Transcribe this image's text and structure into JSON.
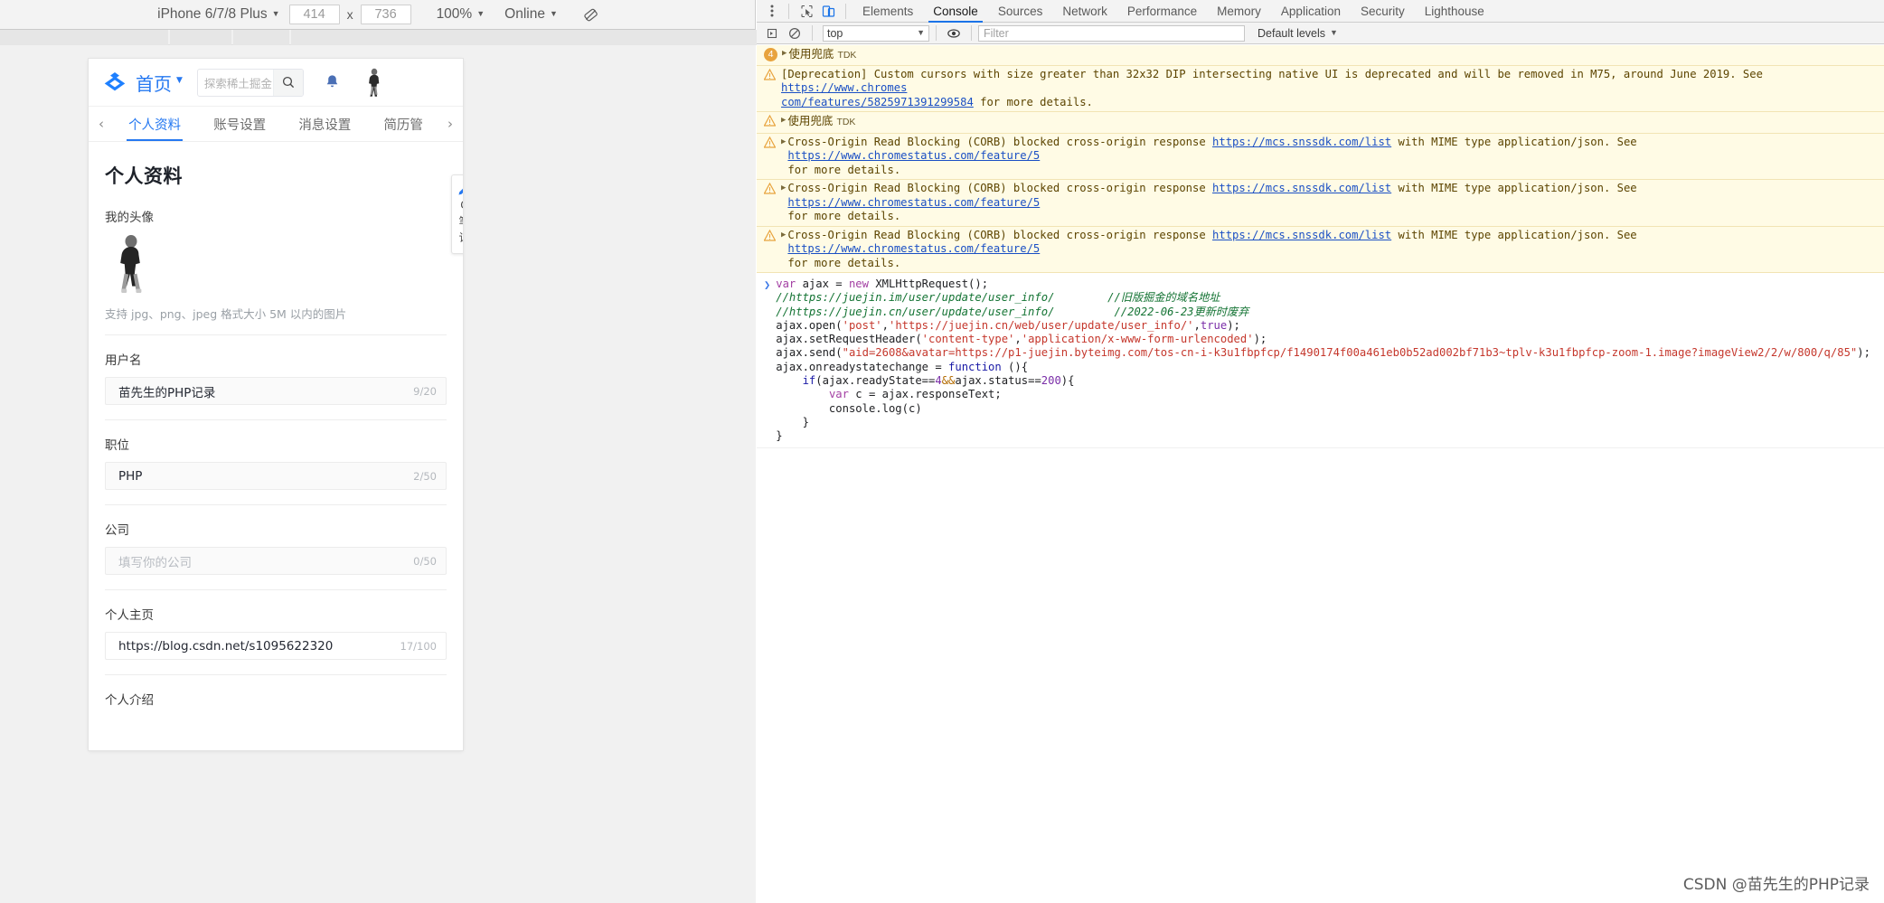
{
  "device_toolbar": {
    "device": "iPhone 6/7/8 Plus",
    "width": "414",
    "height": "736",
    "zoom": "100%",
    "throttling": "Online",
    "rotate_icon": "rotate-icon"
  },
  "phone_page": {
    "header": {
      "logo_icon": "juejin-logo-icon",
      "home_label": "首页",
      "search_placeholder": "探索稀土掘金",
      "search_icon": "search-icon",
      "bell_icon": "notification-bell-icon",
      "avatar_icon": "user-avatar-icon"
    },
    "tabs": {
      "prev_icon": "chevron-left-icon",
      "next_icon": "chevron-right-icon",
      "items": [
        {
          "label": "个人资料",
          "active": true
        },
        {
          "label": "账号设置",
          "active": false
        },
        {
          "label": "消息设置",
          "active": false
        },
        {
          "label": "简历管",
          "active": false
        }
      ]
    },
    "page_title": "个人资料",
    "avatar_section": {
      "label": "我的头像",
      "hint": "支持 jpg、png、jpeg 格式大小 5M 以内的图片"
    },
    "fields": [
      {
        "label": "用户名",
        "value": "苗先生的PHP记录",
        "placeholder": "",
        "count": "9/20",
        "filled": true
      },
      {
        "label": "职位",
        "value": "PHP",
        "placeholder": "",
        "count": "2/50",
        "filled": true
      },
      {
        "label": "公司",
        "value": "",
        "placeholder": "填写你的公司",
        "count": "0/50",
        "filled": true
      },
      {
        "label": "个人主页",
        "value": "https://blog.csdn.net/s1095622320",
        "placeholder": "",
        "count": "17/100",
        "filled": false
      }
    ],
    "bottom_label": "个人介绍",
    "note_widget": {
      "icon": "pencil-note-icon",
      "lines": [
        "C",
        "笔",
        "记"
      ]
    }
  },
  "devtools": {
    "kebab_icon": "more-options-icon",
    "inspect_icon": "inspect-element-icon",
    "device_toggle_icon": "device-toolbar-icon",
    "tabs": [
      {
        "label": "Elements",
        "active": false
      },
      {
        "label": "Console",
        "active": true
      },
      {
        "label": "Sources",
        "active": false
      },
      {
        "label": "Network",
        "active": false
      },
      {
        "label": "Performance",
        "active": false
      },
      {
        "label": "Memory",
        "active": false
      },
      {
        "label": "Application",
        "active": false
      },
      {
        "label": "Security",
        "active": false
      },
      {
        "label": "Lighthouse",
        "active": false
      }
    ],
    "subbar": {
      "clear_icon": "clear-console-icon",
      "sidebar_icon": "console-sidebar-icon",
      "context": "top",
      "eye_icon": "live-expression-icon",
      "filter_placeholder": "Filter",
      "levels": "Default levels"
    },
    "console_messages": [
      {
        "kind": "group-badge",
        "badge": "4",
        "expand_icon": "triangle-right-icon",
        "cjk": "使用兜底",
        "suffix": "TDK"
      },
      {
        "kind": "warning",
        "icon": "warning-triangle-icon",
        "text_before": "[Deprecation] Custom cursors with size greater than 32x32 DIP intersecting native UI is deprecated and will be removed in M75, around June 2019. See ",
        "link1": "https://www.chromes",
        "link2": "com/features/5825971391299584",
        "text_after": " for more details."
      },
      {
        "kind": "warning-cjk",
        "icon": "warning-triangle-icon",
        "expand_icon": "triangle-right-icon",
        "cjk": "使用兜底",
        "suffix": "TDK"
      },
      {
        "kind": "corb",
        "icon": "warning-triangle-icon",
        "expand_icon": "triangle-right-icon",
        "text_before": "Cross-Origin Read Blocking (CORB) blocked cross-origin response ",
        "link1": "https://mcs.snssdk.com/list",
        "text_mid": " with MIME type application/json. See ",
        "link2": "https://www.chromestatus.com/feature/5",
        "text_after": "for more details."
      },
      {
        "kind": "corb",
        "icon": "warning-triangle-icon",
        "expand_icon": "triangle-right-icon",
        "text_before": "Cross-Origin Read Blocking (CORB) blocked cross-origin response ",
        "link1": "https://mcs.snssdk.com/list",
        "text_mid": " with MIME type application/json. See ",
        "link2": "https://www.chromestatus.com/feature/5",
        "text_after": "for more details."
      },
      {
        "kind": "corb",
        "icon": "warning-triangle-icon",
        "expand_icon": "triangle-right-icon",
        "text_before": "Cross-Origin Read Blocking (CORB) blocked cross-origin response ",
        "link1": "https://mcs.snssdk.com/list",
        "text_mid": " with MIME type application/json. See ",
        "link2": "https://www.chromestatus.com/feature/5",
        "text_after": "for more details."
      }
    ],
    "code_entry": {
      "prompt_icon": "chevron-right-icon",
      "lines": [
        "var ajax = new XMLHttpRequest();",
        "//https://juejin.im/user/update/user_info/        //旧版掘金的域名地址",
        "//https://juejin.cn/user/update/user_info/        //2022-06-23更新时废弃",
        "ajax.open('post','https://juejin.cn/web/user/update/user_info/',true);",
        "ajax.setRequestHeader('content-type','application/x-www-form-urlencoded');",
        "ajax.send(\"aid=2608&avatar=https://p1-juejin.byteimg.com/tos-cn-i-k3u1fbpfcp/f1490174f00a461eb0b52ad002bf71b3~tplv-k3u1fbpfcp-zoom-1.image?imageView2/2/w/800/q/85\");",
        "ajax.onreadystatechange = function (){",
        "    if(ajax.readyState==4&&ajax.status==200){",
        "        var c = ajax.responseText;",
        "        console.log(c)",
        "    }",
        "}"
      ]
    }
  },
  "watermark": "CSDN @苗先生的PHP记录",
  "colors": {
    "accent_blue": "#1a73e8",
    "juejin_blue": "#2578f1",
    "warning_bg": "#fffbe5",
    "warning_fg": "#5c4400",
    "link": "#1a4fc4"
  }
}
